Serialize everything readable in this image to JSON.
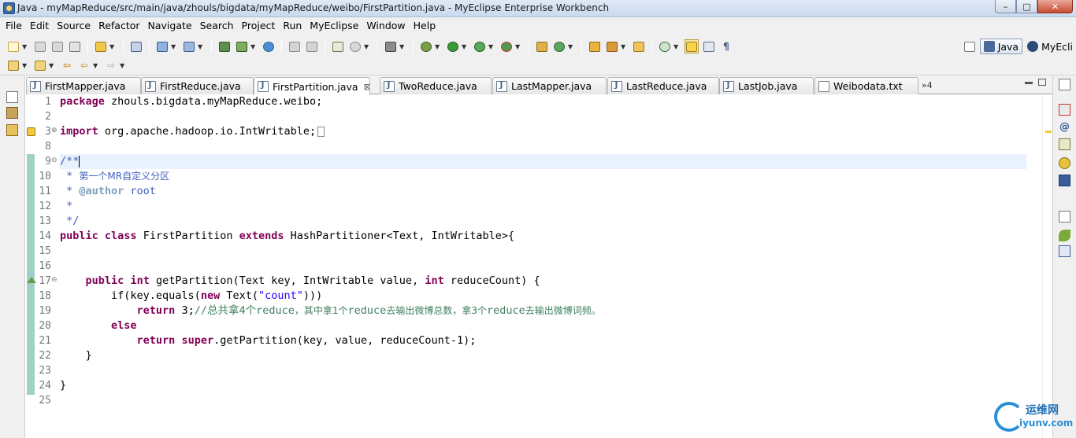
{
  "window": {
    "title": "Java - myMapReduce/src/main/java/zhouls/bigdata/myMapReduce/weibo/FirstPartition.java - MyEclipse Enterprise Workbench",
    "minimize": "–",
    "maximize": "□",
    "close": "✕"
  },
  "menu": [
    "File",
    "Edit",
    "Source",
    "Refactor",
    "Navigate",
    "Search",
    "Project",
    "Run",
    "MyEclipse",
    "Window",
    "Help"
  ],
  "perspectives": [
    {
      "label": "Java",
      "active": true
    },
    {
      "label": "MyEcli",
      "active": false
    }
  ],
  "tabs": [
    {
      "label": "FirstMapper.java",
      "active": false
    },
    {
      "label": "FirstReduce.java",
      "active": false
    },
    {
      "label": "FirstPartition.java",
      "active": true
    },
    {
      "label": "TwoReduce.java",
      "active": false
    },
    {
      "label": "LastMapper.java",
      "active": false
    },
    {
      "label": "LastReduce.java",
      "active": false
    },
    {
      "label": "LastJob.java",
      "active": false
    },
    {
      "label": "Weibodata.txt",
      "active": false
    }
  ],
  "tab_close": "⊠",
  "tab_overflow": "»4",
  "line_numbers": [
    "1",
    "2",
    "3",
    "8",
    "9",
    "10",
    "11",
    "12",
    "13",
    "14",
    "15",
    "16",
    "17",
    "18",
    "19",
    "20",
    "21",
    "22",
    "23",
    "24",
    "25"
  ],
  "code": {
    "l1_kw": "package",
    "l1_rest": " zhouls.bigdata.myMapReduce.weibo;",
    "l3_kw": "import",
    "l3_rest": " org.apache.hadoop.io.IntWritable;",
    "l9": "/**",
    "l10_star": " * ",
    "l10_text": "第一个MR自定义分区",
    "l11_star": " * ",
    "l11_tag": "@author",
    "l11_rest": " root",
    "l12": " *",
    "l13": " */",
    "l14_kw1": "public",
    "l14_kw2": "class",
    "l14_mid": " FirstPartition ",
    "l14_kw3": "extends",
    "l14_rest": " HashPartitioner<Text, IntWritable>{",
    "l17_indent": "    ",
    "l17_kw1": "public",
    "l17_kw2": "int",
    "l17_mid": " getPartition(Text key, IntWritable value, ",
    "l17_kw3": "int",
    "l17_rest": " reduceCount) {",
    "l18_a": "        if(key.equals(",
    "l18_kw": "new",
    "l18_b": " Text(",
    "l18_str": "\"count\"",
    "l18_c": ")))",
    "l19_indent": "            ",
    "l19_kw": "return",
    "l19_mid": " 3;",
    "l19_cm_a": "//总共拿4个",
    "l19_cm_b": "reduce",
    "l19_cm_c": "，其中拿1个",
    "l19_cm_d": "reduce",
    "l19_cm_e": "去输出微博总数，拿3个",
    "l19_cm_f": "reduce",
    "l19_cm_g": "去输出微博词频。",
    "l20_indent": "        ",
    "l20_kw": "else",
    "l21_indent": "            ",
    "l21_kw1": "return",
    "l21_kw2": "super",
    "l21_rest": ".getPartition(key, value, reduceCount-1);",
    "l22": "    }",
    "l24": "}"
  },
  "watermark": {
    "cn": "运维网",
    "en": "iyunv.com"
  },
  "colors": {
    "keyword": "#7f0055",
    "string": "#2a00ff",
    "comment": "#3f7f5f",
    "javadoc": "#3f5fbf",
    "current_line": "#e8f2fe",
    "quickdiff": "#9fd1c4"
  }
}
